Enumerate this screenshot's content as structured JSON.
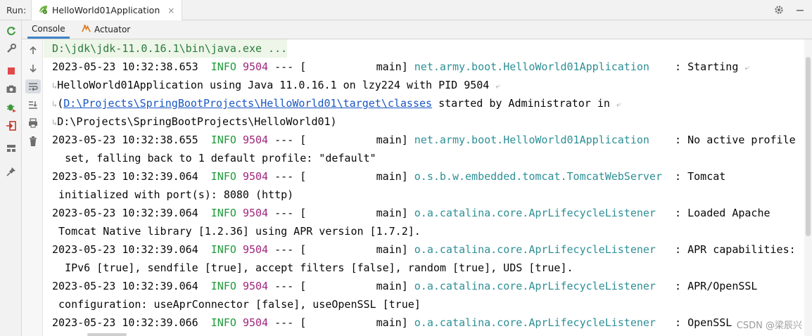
{
  "topbar": {
    "run_label": "Run:",
    "tab_title": "HelloWorld01Application",
    "tab_close": "×",
    "settings_icon": "gear-icon",
    "hide_icon": "minimize-icon"
  },
  "subtabs": [
    {
      "label": "Console",
      "active": true
    },
    {
      "label": "Actuator",
      "active": false
    }
  ],
  "console": {
    "command_line": "D:\\jdk\\jdk-11.0.16.1\\bin\\java.exe ...",
    "logs": [
      {
        "timestamp": "2023-05-23 10:32:38.653",
        "level": "INFO",
        "pid": "9504",
        "sep": "---",
        "thread": "[           main]",
        "logger": "net.army.boot.HelloWorld01Application",
        "message_first": ": Starting",
        "continuation": [
          "HelloWorld01Application using Java 11.0.16.1 on lzy224 with PID 9504",
          "D:\\Projects\\SpringBootProjects\\HelloWorld01\\target\\classes",
          "D:\\Projects\\SpringBootProjects\\HelloWorld01)"
        ],
        "continuation_open": "(",
        "continuation_after_link": " started by Administrator in"
      },
      {
        "timestamp": "2023-05-23 10:32:38.655",
        "level": "INFO",
        "pid": "9504",
        "sep": "---",
        "thread": "[           main]",
        "logger": "net.army.boot.HelloWorld01Application",
        "message_first": ": No active profile",
        "continuation": [
          "set, falling back to 1 default profile: \"default\""
        ]
      },
      {
        "timestamp": "2023-05-23 10:32:39.064",
        "level": "INFO",
        "pid": "9504",
        "sep": "---",
        "thread": "[           main]",
        "logger": "o.s.b.w.embedded.tomcat.TomcatWebServer",
        "message_first": ": Tomcat",
        "continuation": [
          "initialized with port(s): 8080 (http)"
        ]
      },
      {
        "timestamp": "2023-05-23 10:32:39.064",
        "level": "INFO",
        "pid": "9504",
        "sep": "---",
        "thread": "[           main]",
        "logger": "o.a.catalina.core.AprLifecycleListener",
        "message_first": ": Loaded Apache",
        "continuation": [
          "Tomcat Native library [1.2.36] using APR version [1.7.2]."
        ]
      },
      {
        "timestamp": "2023-05-23 10:32:39.064",
        "level": "INFO",
        "pid": "9504",
        "sep": "---",
        "thread": "[           main]",
        "logger": "o.a.catalina.core.AprLifecycleListener",
        "message_first": ": APR capabilities:",
        "continuation": [
          "IPv6 [true], sendfile [true], accept filters [false], random [true], UDS [true]."
        ]
      },
      {
        "timestamp": "2023-05-23 10:32:39.064",
        "level": "INFO",
        "pid": "9504",
        "sep": "---",
        "thread": "[           main]",
        "logger": "o.a.catalina.core.AprLifecycleListener",
        "message_first": ": APR/OpenSSL",
        "continuation": [
          "configuration: useAprConnector [false], useOpenSSL [true]"
        ]
      },
      {
        "timestamp": "2023-05-23 10:32:39.066",
        "level": "INFO",
        "pid": "9504",
        "sep": "---",
        "thread": "[           main]",
        "logger": "o.a.catalina.core.AprLifecycleListener",
        "message_first": ": OpenSSL",
        "continuation": []
      }
    ]
  },
  "watermark": "CSDN @梁辰兴",
  "colors": {
    "info": "#1f9a3a",
    "pid": "#a0267c",
    "logger": "#2d8f95",
    "link": "#1a56c4",
    "accent": "#4083c9"
  }
}
